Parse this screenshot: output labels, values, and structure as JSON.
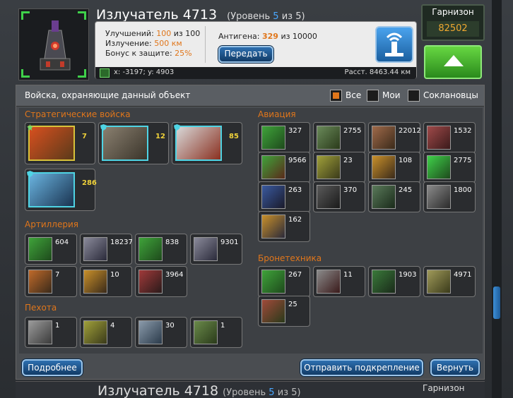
{
  "building": {
    "name": "Излучатель 4713",
    "level_prefix": "(Уровень",
    "level": "5",
    "level_mid": "из",
    "level_max": "5)",
    "upgrades_label": "Улучшений:",
    "upgrades_value": "100",
    "upgrades_of": "из 100",
    "radiation_label": "Излучение:",
    "radiation_value": "500 км",
    "defense_label": "Бонус к защите:",
    "defense_value": "25%",
    "antigen_label": "Антигена:",
    "antigen_value": "329",
    "antigen_of": "из 10000",
    "transfer_label": "Передать",
    "coords": "x: -3197; y: 4903",
    "distance": "Расст. 8463.44 км"
  },
  "garrison": {
    "label": "Гарнизон",
    "value": "82502"
  },
  "panel": {
    "header": "Войска, охраняющие данный объект",
    "filters": [
      {
        "label": "Все",
        "checked": true
      },
      {
        "label": "Мои",
        "checked": false
      },
      {
        "label": "Соклановцы",
        "checked": false
      }
    ]
  },
  "sections": {
    "strategic": {
      "title": "Стратегические войска",
      "counts": [
        "7",
        "12",
        "85",
        "286"
      ]
    },
    "artillery": {
      "title": "Артиллерия",
      "counts": [
        "604",
        "18237",
        "838",
        "9301",
        "7",
        "10",
        "3964"
      ]
    },
    "infantry": {
      "title": "Пехота",
      "counts": [
        "1",
        "4",
        "30",
        "1"
      ]
    },
    "aviation": {
      "title": "Авиация",
      "counts": [
        "327",
        "2755",
        "22012",
        "1532",
        "9566",
        "23",
        "108",
        "2775",
        "263",
        "370",
        "245",
        "1800",
        "162"
      ]
    },
    "armor": {
      "title": "Бронетехника",
      "counts": [
        "267",
        "11",
        "1903",
        "4971",
        "25"
      ]
    }
  },
  "buttons": {
    "details": "Подробнее",
    "reinforce": "Отправить подкрепление",
    "back": "Вернуть"
  },
  "next": {
    "name": "Излучатель 4718",
    "level_prefix": "(Уровень",
    "level": "5",
    "level_suffix": "из 5)",
    "garrison": "Гарнизон"
  }
}
